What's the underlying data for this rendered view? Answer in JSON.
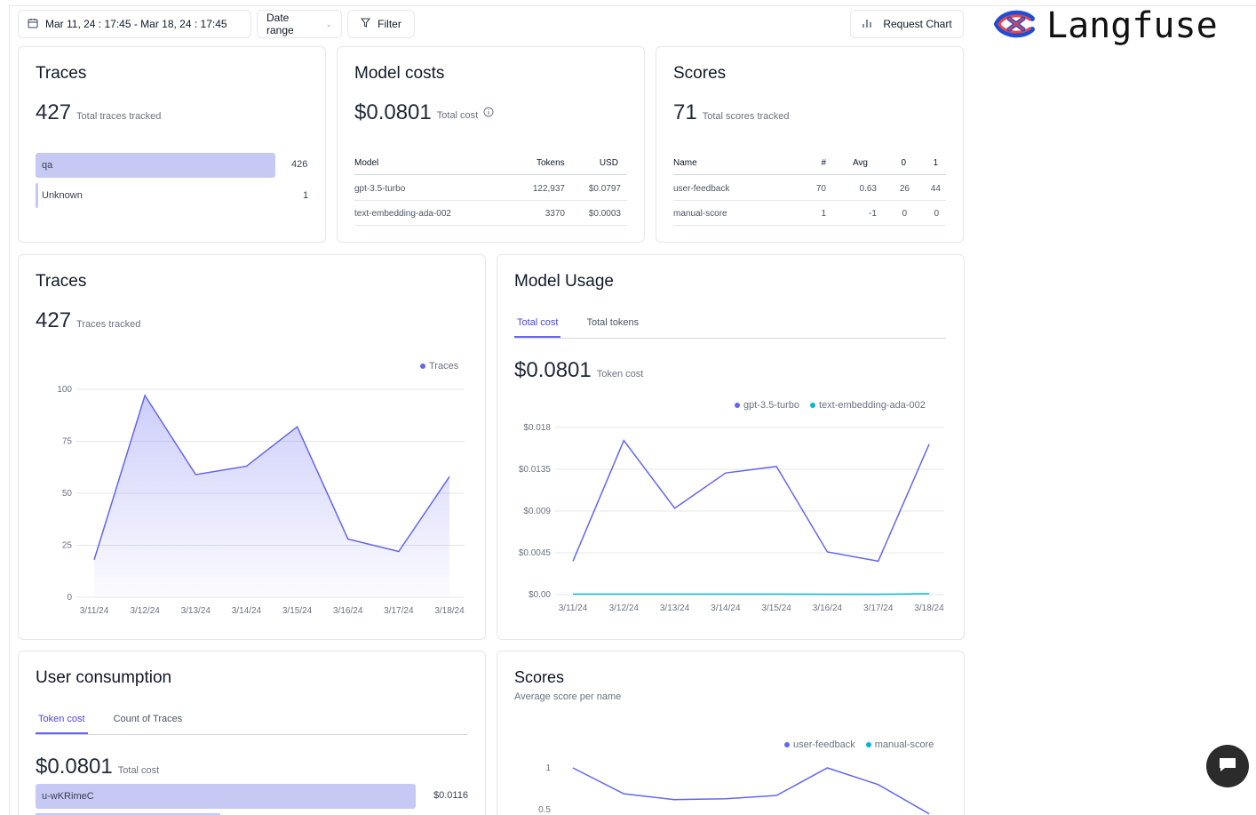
{
  "toolbar": {
    "date_label": "Mar 11, 24 : 17:45 - Mar 18, 24 : 17:45",
    "date_range_label": "Date range",
    "filter_label": "Filter",
    "request_chart_label": "Request Chart"
  },
  "brand": {
    "name": "Langfuse"
  },
  "traces_summary": {
    "title": "Traces",
    "total": "427",
    "total_label": "Total traces tracked",
    "rows": [
      {
        "name": "qa",
        "count": "426"
      },
      {
        "name": "Unknown",
        "count": "1"
      }
    ]
  },
  "model_costs": {
    "title": "Model costs",
    "total": "$0.0801",
    "total_label": "Total cost",
    "headers": [
      "Model",
      "Tokens",
      "USD"
    ],
    "rows": [
      {
        "model": "gpt-3.5-turbo",
        "tokens": "122,937",
        "usd": "$0.0797"
      },
      {
        "model": "text-embedding-ada-002",
        "tokens": "3370",
        "usd": "$0.0003"
      }
    ]
  },
  "scores_summary": {
    "title": "Scores",
    "total": "71",
    "total_label": "Total scores tracked",
    "headers": [
      "Name",
      "#",
      "Avg",
      "0",
      "1"
    ],
    "rows": [
      {
        "name": "user-feedback",
        "count": "70",
        "avg": "0.63",
        "zero": "26",
        "one": "44"
      },
      {
        "name": "manual-score",
        "count": "1",
        "avg": "-1",
        "zero": "0",
        "one": "0"
      }
    ]
  },
  "traces_chart": {
    "title": "Traces",
    "total": "427",
    "total_label": "Traces tracked",
    "legend": "Traces",
    "color": "#6366f1"
  },
  "model_usage": {
    "title": "Model Usage",
    "tabs": [
      "Total cost",
      "Total tokens"
    ],
    "total": "$0.0801",
    "total_label": "Token cost",
    "colors": {
      "gpt": "#6366f1",
      "ada": "#06b6d4"
    }
  },
  "user_consumption": {
    "title": "User consumption",
    "tabs": [
      "Token cost",
      "Count of Traces"
    ],
    "total": "$0.0801",
    "total_label": "Total cost",
    "rows": [
      {
        "user": "u-wKRimeC",
        "cost": "$0.0116"
      }
    ]
  },
  "scores_chart": {
    "title": "Scores",
    "subtitle": "Average score per name",
    "legend": [
      "user-feedback",
      "manual-score"
    ]
  },
  "chart_data": [
    {
      "type": "area",
      "categories": [
        "3/11/24",
        "3/12/24",
        "3/13/24",
        "3/14/24",
        "3/15/24",
        "3/16/24",
        "3/17/24",
        "3/18/24"
      ],
      "series": [
        {
          "name": "Traces",
          "values": [
            18,
            97,
            59,
            63,
            82,
            28,
            22,
            58
          ]
        }
      ],
      "yticks": [
        "0",
        "25",
        "50",
        "75",
        "100"
      ],
      "ylim": [
        0,
        100
      ]
    },
    {
      "type": "line",
      "categories": [
        "3/11/24",
        "3/12/24",
        "3/13/24",
        "3/14/24",
        "3/15/24",
        "3/16/24",
        "3/17/24",
        "3/18/24"
      ],
      "series": [
        {
          "name": "gpt-3.5-turbo",
          "values": [
            0.0036,
            0.0166,
            0.0093,
            0.0131,
            0.0138,
            0.0046,
            0.0036,
            0.0162
          ]
        },
        {
          "name": "text-embedding-ada-002",
          "values": [
            5e-05,
            5e-05,
            5e-05,
            5e-05,
            5e-05,
            3e-05,
            3e-05,
            0.0001
          ]
        }
      ],
      "yticks": [
        "$0.00",
        "$0.0045",
        "$0.009",
        "$0.0135",
        "$0.018"
      ],
      "ylim": [
        0,
        0.018
      ]
    },
    {
      "type": "line",
      "series": [
        {
          "name": "user-feedback",
          "values": [
            1,
            0.69,
            0.62,
            0.63,
            0.67,
            1,
            0.8,
            0.45
          ]
        }
      ],
      "yticks": [
        "1",
        "0.5"
      ]
    }
  ]
}
